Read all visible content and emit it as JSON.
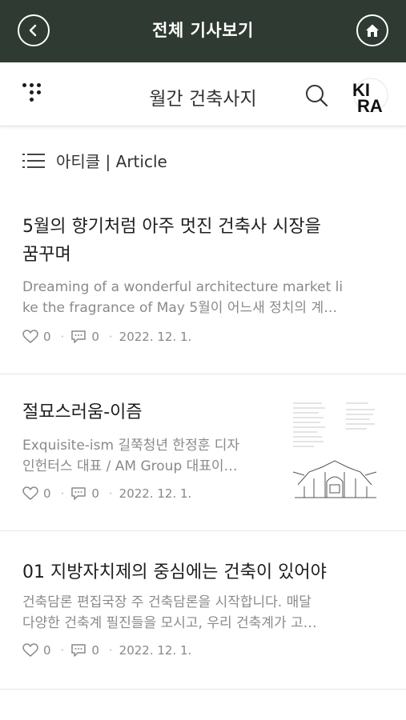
{
  "topbar": {
    "title": "전체 기사보기",
    "back_icon": "chevron-left-icon",
    "home_icon": "home-icon",
    "bg_color": "#2f3a33"
  },
  "header": {
    "site_title": "월간 건축사지",
    "menu_icon": "dots-menu-icon",
    "search_icon": "search-icon",
    "logo_text": "KIRA"
  },
  "section": {
    "label": "아티클 | Article",
    "icon": "list-icon"
  },
  "articles": [
    {
      "title_line1": "5월의 향기처럼 아주 멋진 건축사 시장을",
      "title_line2": "꿈꾸며",
      "desc_line1": "Dreaming of a wonderful architecture market li",
      "desc_line2": "ke the fragrance of May 5월이 어느새 정치의 계…",
      "likes": "0",
      "comments": "0",
      "date": "2022. 12. 1."
    },
    {
      "title_line1": "절묘스러움-이즘",
      "desc_line1": "Exquisite-ism 길쭉청년 한정훈 디자",
      "desc_line2": "인헌터스 대표 / AM Group 대표이…",
      "likes": "0",
      "comments": "0",
      "date": "2022. 12. 1.",
      "has_thumbnail": true
    },
    {
      "title_line1": "01 지방자치제의 중심에는 건축이 있어야",
      "desc_line1": "건축담론 편집국장 주 건축담론을 시작합니다. 매달",
      "desc_line2": "다양한 건축계 필진들을 모시고, 우리 건축계가 고…",
      "likes": "0",
      "comments": "0",
      "date": "2022. 12. 1."
    }
  ]
}
